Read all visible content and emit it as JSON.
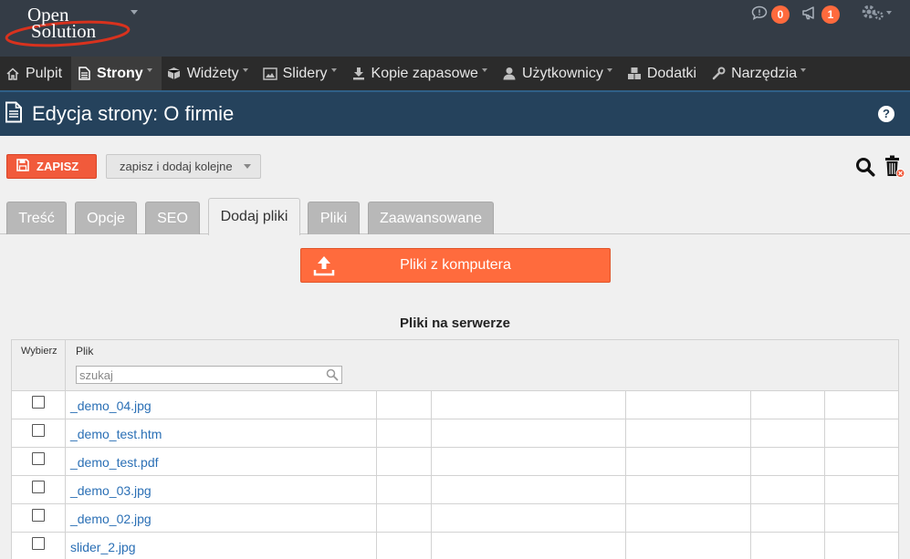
{
  "logo": {
    "line1": "Open",
    "line2": "Solution"
  },
  "header": {
    "comments_count": "0",
    "notifications_count": "1"
  },
  "nav": [
    {
      "label": "Pulpit",
      "icon": "home-icon",
      "dropdown": false,
      "active": false
    },
    {
      "label": "Strony",
      "icon": "document-icon",
      "dropdown": true,
      "active": true
    },
    {
      "label": "Widżety",
      "icon": "cube-icon",
      "dropdown": true,
      "active": false
    },
    {
      "label": "Slidery",
      "icon": "image-icon",
      "dropdown": true,
      "active": false
    },
    {
      "label": "Kopie zapasowe",
      "icon": "download-icon",
      "dropdown": true,
      "active": false
    },
    {
      "label": "Użytkownicy",
      "icon": "user-icon",
      "dropdown": true,
      "active": false
    },
    {
      "label": "Dodatki",
      "icon": "cubes-icon",
      "dropdown": false,
      "active": false
    },
    {
      "label": "Narzędzia",
      "icon": "wrench-icon",
      "dropdown": true,
      "active": false
    }
  ],
  "page": {
    "title": "Edycja strony: O firmie",
    "help": "?"
  },
  "toolbar": {
    "save": "ZAPISZ",
    "save_and_add": "zapisz i dodaj kolejne"
  },
  "tabs": [
    {
      "label": "Treść",
      "active": false
    },
    {
      "label": "Opcje",
      "active": false
    },
    {
      "label": "SEO",
      "active": false
    },
    {
      "label": "Dodaj pliki",
      "active": true
    },
    {
      "label": "Pliki",
      "active": false
    },
    {
      "label": "Zaawansowane",
      "active": false
    }
  ],
  "upload": {
    "label": "Pliki z komputera"
  },
  "files": {
    "title": "Pliki na serwerze",
    "col_select": "Wybierz",
    "col_file": "Plik",
    "search_placeholder": "szukaj",
    "rows": [
      "_demo_04.jpg",
      "_demo_test.htm",
      "_demo_test.pdf",
      "_demo_03.jpg",
      "_demo_02.jpg",
      "slider_2.jpg"
    ]
  },
  "colors": {
    "topbar": "#343c46",
    "navbar": "#2b2b2b",
    "titlebar": "#25425c",
    "accent": "#ff6b3d",
    "badge": "#ff6a3d",
    "link": "#2a6fb5"
  }
}
